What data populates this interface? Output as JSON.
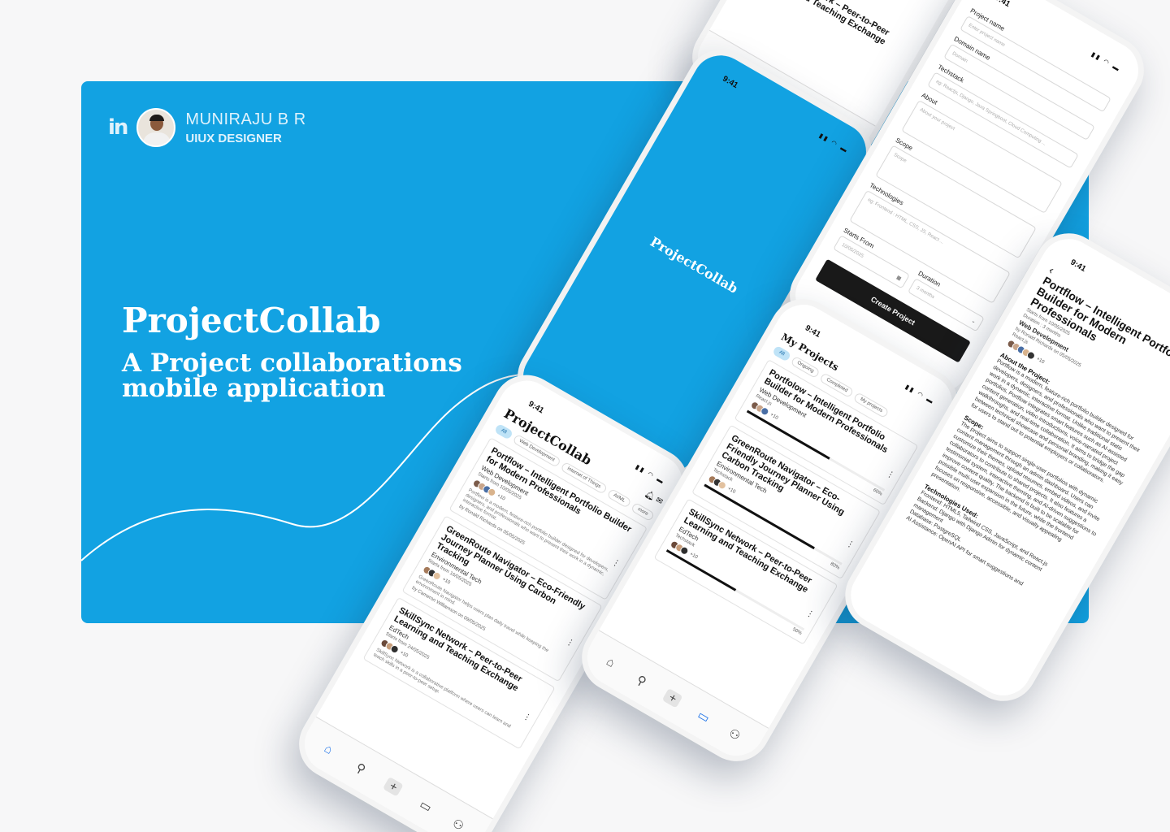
{
  "author": {
    "logo_text": "in",
    "name": "MUNIRAJU B R",
    "role": "UIUX DESIGNER"
  },
  "hero": {
    "title": "ProjectCollab",
    "subtitle_line1": "A Project collaborations",
    "subtitle_line2": "mobile application"
  },
  "status": {
    "time": "9:41"
  },
  "splash": {
    "brand": "ProjectCollab"
  },
  "home": {
    "brand": "ProjectCollab",
    "filters": [
      "All",
      "Web Development",
      "Internet of Things",
      "AI/ML",
      "more"
    ],
    "cards": [
      {
        "title": "Portflow – Intelligent Portfolio Builder for Modern Professionals",
        "domain": "Web Development",
        "starts": "Starts from 10/05/2025",
        "desc": "Portflow is a modern, feature-rich portfolio builder designed for developers, designers, and professionals who want to present their work in a dynamic, interactive format.",
        "byline": "by Ronald Richards on 05/05/2025",
        "more": "+10"
      },
      {
        "title": "GreenRoute Navigator – Eco-Friendly Journey Planner Using Carbon Tracking",
        "domain": "Environmental Tech",
        "starts": "Starts from 16/05/2025",
        "desc": "GreenRoute Navigator helps users plan daily travel while keeping the environment in mind.",
        "byline": "by Cameron Williamson on 09/05/2025",
        "more": "+10"
      },
      {
        "title": "SkillSync Network – Peer-to-Peer Learning and Teaching Exchange",
        "domain": "EdTech",
        "starts": "Starts from 24/05/2025",
        "desc": "SkillSync Network is a collaborative platform where users can learn and teach skills in a peer-to-peer setup.",
        "byline": "",
        "more": "+10"
      }
    ]
  },
  "my_projects": {
    "title": "My Projects",
    "filters": [
      "All",
      "Ongoing",
      "Completed",
      "My projects"
    ],
    "cards": [
      {
        "title": "Portfolow – Intelligent Portfolio Builder for Modern Professionals",
        "domain": "Web Development",
        "tech": "React.js",
        "more": "+10",
        "progress": 0.6,
        "progress_label": "60%"
      },
      {
        "title": "GreenRoute Navigator – Eco-Friendly Journey Planner Using Carbon Tracking",
        "domain": "Environmental Tech",
        "tech": "Techstack",
        "more": "+10",
        "progress": 0.8,
        "progress_label": "80%"
      },
      {
        "title": "SkillSync Network – Peer-to-Peer Learning and Teaching Exchange",
        "domain": "EdTech",
        "tech": "Techstack",
        "more": "+10",
        "progress": 0.5,
        "progress_label": "50%"
      }
    ]
  },
  "top_phone": {
    "title": "SkillSync Network – Peer-to-Peer Learning and Teaching Exchange"
  },
  "form": {
    "fields": [
      {
        "label": "Project name",
        "placeholder": "Enter project name"
      },
      {
        "label": "Domain name",
        "placeholder": "Domain"
      },
      {
        "label": "Techstack",
        "placeholder": "eg: Reactjs, Django, Java Springboot, Cloud Computing ..."
      },
      {
        "label": "About",
        "placeholder": "About your project"
      },
      {
        "label": "Scope",
        "placeholder": "Scope"
      },
      {
        "label": "Technologies",
        "placeholder": "eg: Frontend : HTML, CSS, JS, React ..."
      }
    ],
    "starts_label": "Starts From",
    "starts_value": "10/05/2025",
    "duration_label": "Duration",
    "duration_value": "3 months",
    "button": "Create Project"
  },
  "detail": {
    "title": "Portflow – Intelligent Portfolio Builder for Modern Professionals",
    "starts": "Starts from 10/05/2025",
    "duration": "Duration : 3 months",
    "domain": "Web Development",
    "byline": "by Ronald Richards on 05/05/2025",
    "tech": "React.js",
    "more": "+10",
    "about_heading": "About the Project:",
    "about": "Portflow is a modern, feature-rich portfolio builder designed for developers, designers, and professionals who want to present their work in a dynamic, interactive format. Unlike traditional static portfolios, Portflow integrates smart features such as AI-assisted content generation, video introductions, voice-narrated project walkthroughs, and real-time collaboration. It aims to bridge the gap between technical showcase and personal branding, making it easy for users to stand out to potential employers or collaborators.",
    "scope_heading": "Scope:",
    "scope": "The project aims to support single-user portfolios with dynamic content management through an admin dashboard. Users can customize their themes, upload resumes, embed videos, and invite collaborators to contribute to shared projects. It also features a testimonial system, interactive theming, and AI-driven suggestions to improve content quality. The backend is built to be scalable for possible multi-user expansion in the future, while the frontend focuses on responsive, accessible, and visually appealing presentation.",
    "tech_heading": "Technologies Used:",
    "tech_list": [
      "Frontend: HTML5, Tailwind CSS, JavaScript, and React.js",
      "Backend: Django with Django Admin for dynamic content management",
      "Database: PostgreSQL",
      "AI Assistance: OpenAI API for smart suggestions and"
    ]
  },
  "colors": {
    "banner": "#12a2e2",
    "accent": "#1f73e8",
    "chip_active": "#bfe3f7",
    "button": "#191919"
  },
  "icons": [
    "home-icon",
    "search-icon",
    "plus-icon",
    "folder-icon",
    "profile-icon",
    "bell-icon",
    "chat-icon",
    "back-icon",
    "calendar-icon",
    "chevron-down-icon"
  ]
}
